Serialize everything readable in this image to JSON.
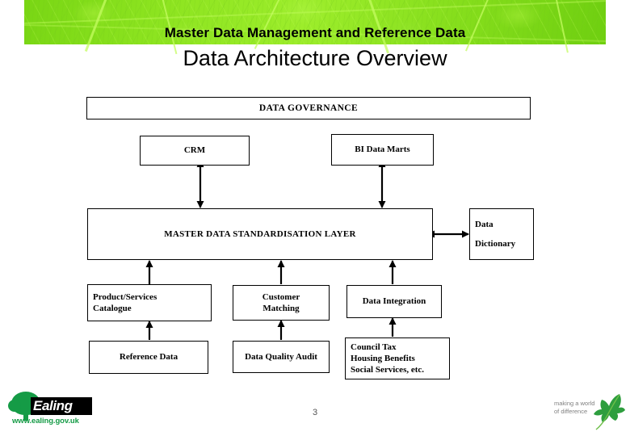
{
  "slide": {
    "banner_title": "Master Data Management and Reference Data",
    "subtitle": "Data Architecture Overview",
    "page_number": "3",
    "banner_color": "#8ce31f"
  },
  "diagram": {
    "boxes": [
      {
        "id": "data-governance",
        "label": "DATA  GOVERNANCE"
      },
      {
        "id": "crm",
        "label": "CRM"
      },
      {
        "id": "bi-data-marts",
        "label": "BI Data Marts"
      },
      {
        "id": "master-data-layer",
        "label": "MASTER DATA  STANDARDISATION  LAYER"
      },
      {
        "id": "data-dictionary-l1",
        "label": "Data"
      },
      {
        "id": "data-dictionary-l2",
        "label": "Dictionary"
      },
      {
        "id": "product-services-l1",
        "label": "Product/Services"
      },
      {
        "id": "product-services-l2",
        "label": "Catalogue"
      },
      {
        "id": "customer-matching-l1",
        "label": "Customer"
      },
      {
        "id": "customer-matching-l2",
        "label": "Matching"
      },
      {
        "id": "data-integration",
        "label": "Data Integration"
      },
      {
        "id": "reference-data",
        "label": "Reference Data"
      },
      {
        "id": "data-quality-audit",
        "label": "Data Quality Audit"
      },
      {
        "id": "services-l1",
        "label": "Council Tax"
      },
      {
        "id": "services-l2",
        "label": "Housing Benefits"
      },
      {
        "id": "services-l3",
        "label": "Social Services, etc."
      }
    ]
  },
  "footer": {
    "ealing_name": "Ealing",
    "ealing_url": "www.ealing.gov.uk",
    "tagline_line1": "making a world",
    "tagline_line2": "of difference"
  }
}
